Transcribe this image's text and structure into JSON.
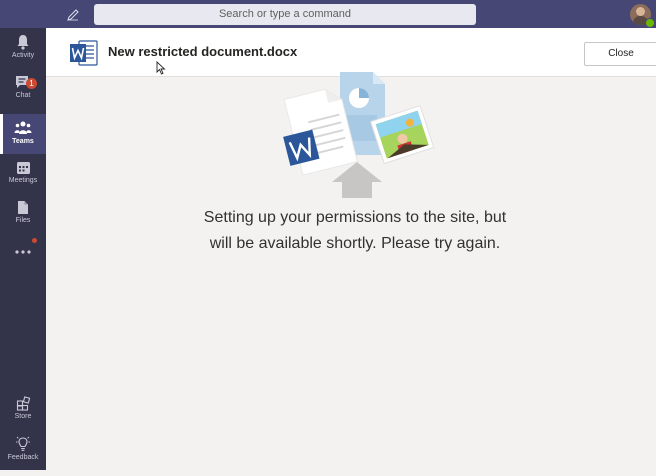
{
  "topbar": {
    "search_placeholder": "Search or type a command"
  },
  "rail": {
    "items": [
      {
        "label": "Activity",
        "icon": "bell-icon"
      },
      {
        "label": "Chat",
        "icon": "chat-icon",
        "badge": "1"
      },
      {
        "label": "Teams",
        "icon": "teams-icon",
        "active": true
      },
      {
        "label": "Meetings",
        "icon": "calendar-icon"
      },
      {
        "label": "Files",
        "icon": "file-icon"
      },
      {
        "label": "",
        "icon": "more-icon"
      },
      {
        "label": "Store",
        "icon": "store-icon"
      },
      {
        "label": "Feedback",
        "icon": "lightbulb-icon"
      }
    ]
  },
  "header": {
    "title": "New restricted document.docx",
    "close_label": "Close"
  },
  "main": {
    "message": "Setting up your permissions to the site, but will be available shortly. Please try again."
  },
  "colors": {
    "topbar": "#464775",
    "rail": "#33344a",
    "word_blue": "#2b579a",
    "badge": "#cc4a31"
  }
}
